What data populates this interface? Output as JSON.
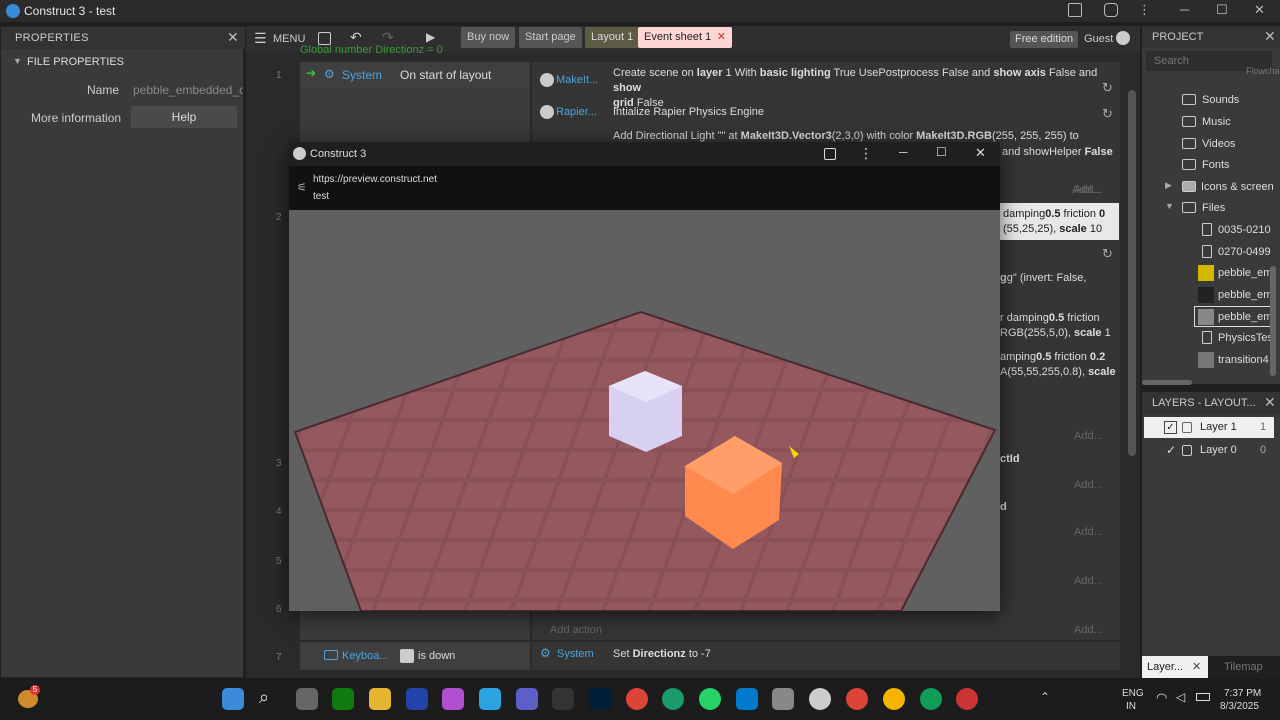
{
  "window": {
    "title": "Construct 3 - test"
  },
  "properties": {
    "header": "PROPERTIES",
    "section": "FILE PROPERTIES",
    "name_label": "Name",
    "name_value": "pebble_embedded_con",
    "more_label": "More information",
    "help_label": "Help"
  },
  "toolbar": {
    "menu": "MENU",
    "tabs": [
      "Buy now",
      "Start page",
      "Layout 1",
      "Event sheet 1"
    ],
    "free_edition": "Free edition",
    "guest": "Guest"
  },
  "events": {
    "partial_top": "Global number Directionz = 0",
    "line1": "1",
    "ev1_obj": "System",
    "ev1_cond": "On start of layout",
    "act1_obj": "MakeIt...",
    "act1_pre": "Create scene on ",
    "act1_b1": "layer",
    "act1_m1": " 1 With ",
    "act1_b2": "basic lighting",
    "act1_m2": " True UsePostprocess False and ",
    "act1_b3": "show axis",
    "act1_m3": " False and ",
    "act1_b4": "show",
    "act1_b5": "grid",
    "act1_m4": " False",
    "act2_obj": "Rapier...",
    "act2_text": "Intialize Rapier Physics Engine",
    "act3_pre": "Add Directional Light \"\" at ",
    "act3_b1": "MakeIt3D.Vector3",
    "act3_m1": "(2,3,0) with color ",
    "act3_b2": "MakeIt3D.RGB",
    "act3_m2": "(255, 255, 255) to",
    "act3_r": "and showHelper ",
    "act3_rb": "False",
    "add_action": "Add...",
    "ln2": "2",
    "ln3": "3",
    "ln4": "4",
    "ln5": "5",
    "ln6": "6",
    "ln7": "7",
    "r1a": "damping",
    "r1b": "0.5",
    "r1c": " friction ",
    "r1d": "0",
    "r1e": "(55,25,25), ",
    "r1f": "scale",
    "r1g": " 10",
    "r2a": "g\" (invert: False,",
    "r3a": "r damping",
    "r3b": "0.5",
    "r3c": " friction",
    "r3d": "RGB(255,5,0), ",
    "r3e": "scale",
    "r3f": " 1",
    "r4a": "amping",
    "r4b": "0.5",
    "r4c": " friction ",
    "r4d": "0.2",
    "r4e": "A(55,55,255,0.8), ",
    "r4f": "scale",
    "r5": "ctId",
    "r6": "d",
    "ln6_obj": "System",
    "add_action2": "Add action",
    "ev7_obj": "Keyboa...",
    "ev7_cond": "is down",
    "ev7_act_obj": "System",
    "ev7_act_pre": "Set ",
    "ev7_act_b": "Directionz",
    "ev7_act_post": " to -7"
  },
  "preview": {
    "title": "Construct 3",
    "url": "https://preview.construct.net",
    "page": "test"
  },
  "project": {
    "header": "PROJECT",
    "search_placeholder": "Search",
    "partial": "Flowchart",
    "items": [
      "Sounds",
      "Music",
      "Videos",
      "Fonts",
      "Icons & screen",
      "Files",
      "0035-0210",
      "0270-0499",
      "pebble_em",
      "pebble_em",
      "pebble_em",
      "PhysicsTes",
      "transition4"
    ]
  },
  "layers": {
    "header": "LAYERS - LAYOUT...",
    "items": [
      {
        "name": "Layer 1",
        "index": "1"
      },
      {
        "name": "Layer 0",
        "index": "0"
      }
    ],
    "bottom_tab": "Layer...",
    "tilemap": "Tilemap"
  },
  "taskbar": {
    "badge": "5",
    "lang1": "ENG",
    "lang2": "IN",
    "time": "7:37 PM",
    "date": "8/3/2025"
  },
  "colors": {
    "accent": "#3b8bd9",
    "active_tab": "#ffd6d6",
    "cube_white": "#d8d0f0",
    "cube_orange": "#ff8a50",
    "floor": "#8a5058"
  }
}
